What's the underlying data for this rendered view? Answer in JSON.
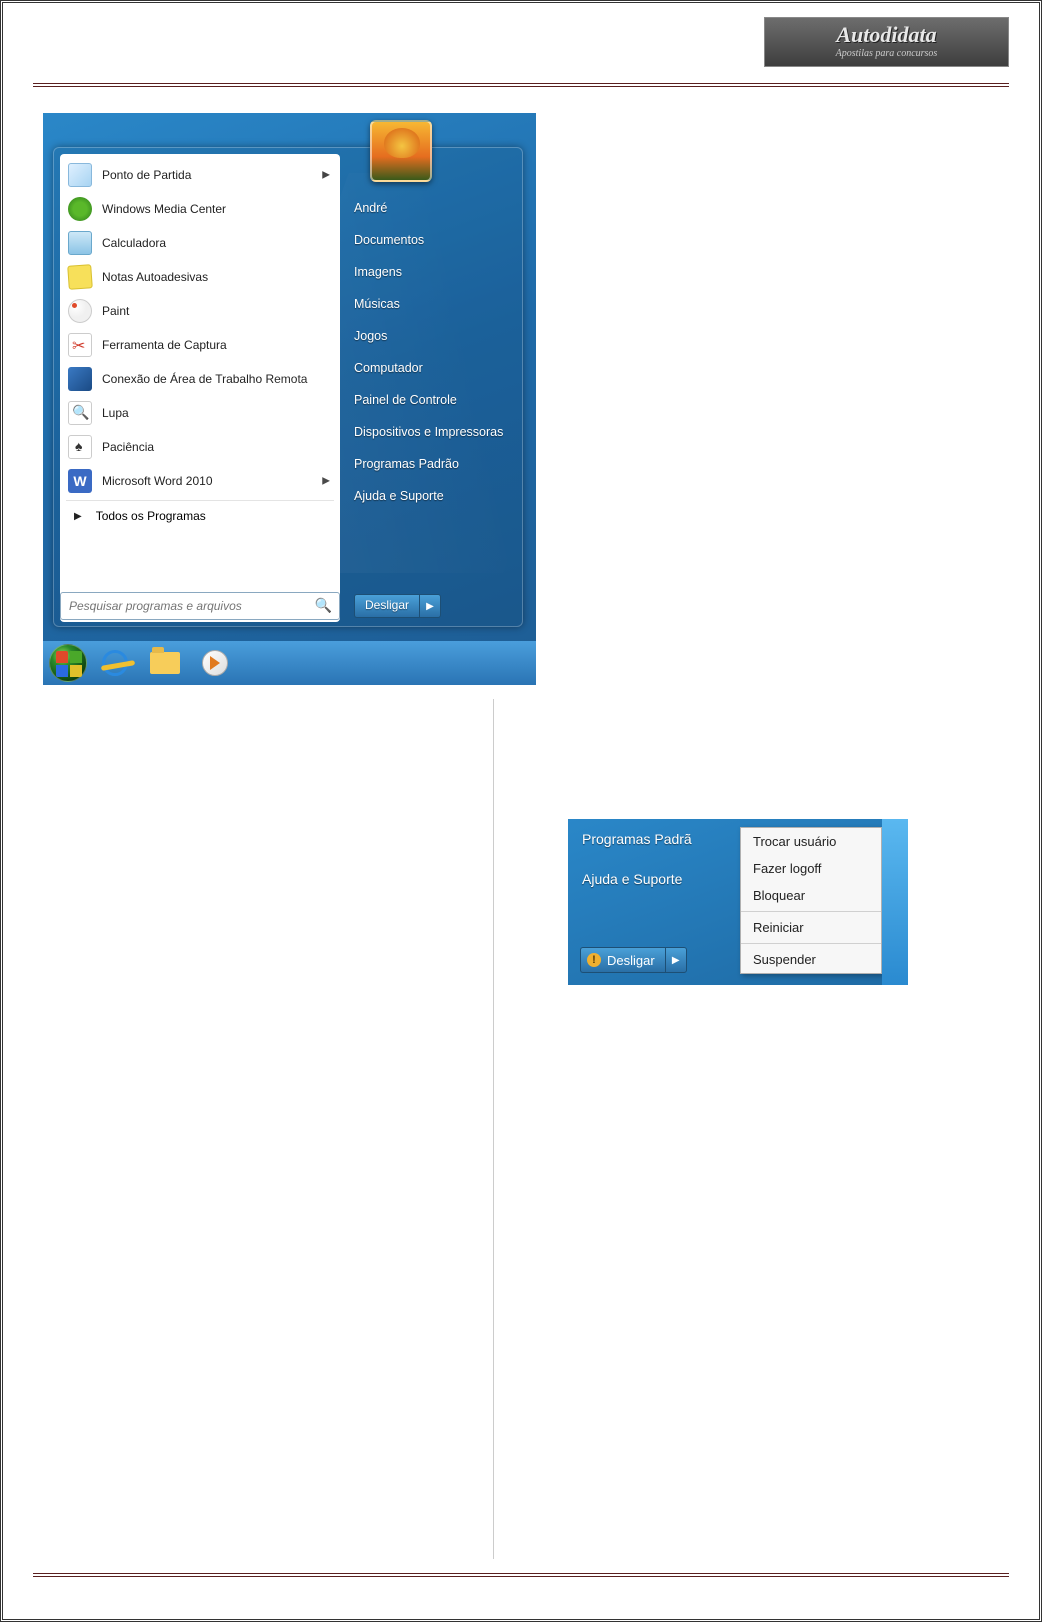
{
  "header": {
    "logo_title": "Autodidata",
    "logo_subtitle": "Apostilas para concursos"
  },
  "start_menu": {
    "programs": [
      {
        "label": "Ponto de Partida",
        "has_submenu": true,
        "icon": "partida"
      },
      {
        "label": "Windows Media Center",
        "has_submenu": false,
        "icon": "wmc"
      },
      {
        "label": "Calculadora",
        "has_submenu": false,
        "icon": "calc"
      },
      {
        "label": "Notas Autoadesivas",
        "has_submenu": false,
        "icon": "notas"
      },
      {
        "label": "Paint",
        "has_submenu": false,
        "icon": "paint"
      },
      {
        "label": "Ferramenta de Captura",
        "has_submenu": false,
        "icon": "snip"
      },
      {
        "label": "Conexão de Área de Trabalho Remota",
        "has_submenu": false,
        "icon": "rdp"
      },
      {
        "label": "Lupa",
        "has_submenu": false,
        "icon": "lupa"
      },
      {
        "label": "Paciência",
        "has_submenu": false,
        "icon": "pac"
      },
      {
        "label": "Microsoft Word 2010",
        "has_submenu": true,
        "icon": "word"
      }
    ],
    "all_programs": "Todos os Programas",
    "search_placeholder": "Pesquisar programas e arquivos",
    "right_items": [
      "André",
      "Documentos",
      "Imagens",
      "Músicas",
      "Jogos",
      "Computador",
      "Painel de Controle",
      "Dispositivos e Impressoras",
      "Programas Padrão",
      "Ajuda e Suporte"
    ],
    "shutdown_label": "Desligar"
  },
  "taskbar": {
    "items": [
      "start-orb",
      "internet-explorer",
      "file-explorer",
      "windows-media-player"
    ]
  },
  "shutdown_detail": {
    "right_items": [
      "Programas Padrã",
      "Ajuda e Suporte"
    ],
    "shutdown_label": "Desligar",
    "menu": [
      "Trocar usuário",
      "Fazer logoff",
      "Bloquear",
      "Reiniciar",
      "Suspender"
    ]
  }
}
